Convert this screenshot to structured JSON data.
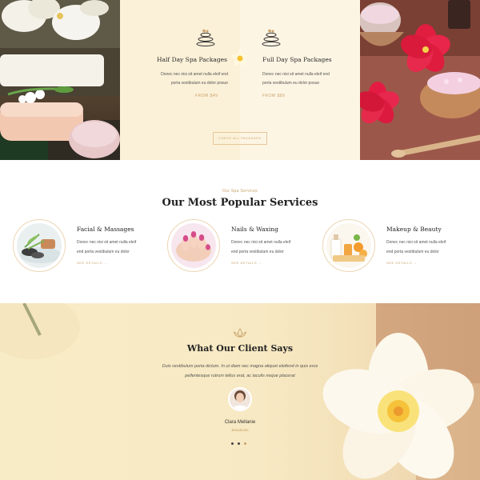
{
  "packages": {
    "items": [
      {
        "title": "Half Day Spa Packages",
        "desc_line1": "Donec nec nisi sit amet nulla eleif end",
        "desc_line2": "porta vestibulum eu dolor posue",
        "price": "FROM $49",
        "icon": "spa-stones-icon"
      },
      {
        "title": "Full Day Spa Packages",
        "desc_line1": "Donec nec nisi sit amet nulla eleif end",
        "desc_line2": "porta vestibulum eu dolor posue",
        "price": "FROM $89",
        "icon": "spa-stones-icon"
      }
    ],
    "button_label": "CHECK ALL PACKAGES"
  },
  "services": {
    "kicker": "Our Spa Services",
    "heading": "Our Most Popular Services",
    "items": [
      {
        "name": "Facial & Massages",
        "desc_line1": "Donec nec nisi sit amet nulla eleif",
        "desc_line2": "end porta vestibulum eu dolor",
        "link": "SEE DETAILS →"
      },
      {
        "name": "Nails & Waxing",
        "desc_line1": "Donec nec nisi sit amet nulla eleif",
        "desc_line2": "end porta vestibulum eu dolor",
        "link": "SEE DETAILS →"
      },
      {
        "name": "Makeup & Beauty",
        "desc_line1": "Donec nec nisi sit amet nulla eleif",
        "desc_line2": "end porta vestibulum eu dolor",
        "link": "SEE DETAILS →"
      }
    ]
  },
  "testimonials": {
    "heading": "What Our Client Says",
    "quote_line1": "Duis vestibulum porta dictum. In ut diam nec magna aliquet eleifend in quis eros",
    "quote_line2": "pellentesque rutrum tellus erat, ac iaculis neque placerat",
    "name": "Clara Mellanie",
    "role": "Beautician",
    "active_dot": 3
  },
  "colors": {
    "accent": "#c9a26b",
    "panel_cream": "#fbf1d8",
    "heading_text": "#222222"
  }
}
